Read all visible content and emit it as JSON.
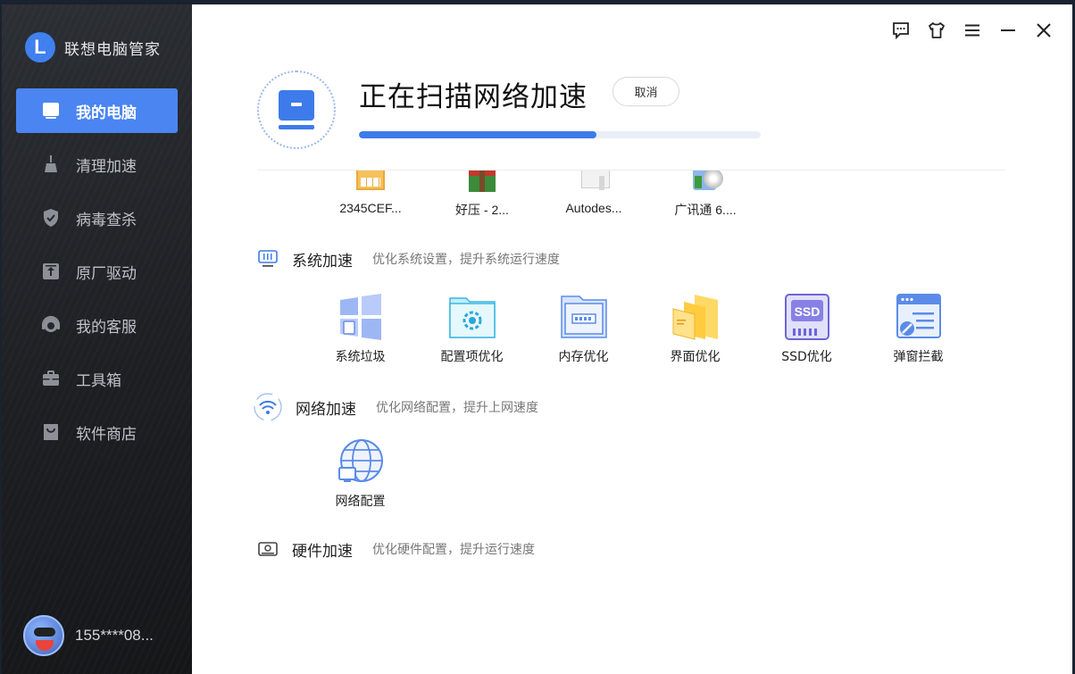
{
  "brand": {
    "logo_letter": "L",
    "name": "联想电脑管家"
  },
  "sidebar": {
    "items": [
      {
        "label": "我的电脑",
        "icon": "laptop-icon",
        "active": true
      },
      {
        "label": "清理加速",
        "icon": "broom-icon",
        "active": false
      },
      {
        "label": "病毒查杀",
        "icon": "shield-icon",
        "active": false
      },
      {
        "label": "原厂驱动",
        "icon": "upload-box-icon",
        "active": false
      },
      {
        "label": "我的客服",
        "icon": "headset-icon",
        "active": false
      },
      {
        "label": "工具箱",
        "icon": "toolbox-icon",
        "active": false
      },
      {
        "label": "软件商店",
        "icon": "bag-icon",
        "active": false
      }
    ],
    "user": {
      "name": "155****08..."
    }
  },
  "window": {
    "controls": [
      "feedback-icon",
      "skin-shirt-icon",
      "menu-icon",
      "minimize-icon",
      "close-icon"
    ]
  },
  "scan": {
    "title": "正在扫描网络加速",
    "cancel_label": "取消",
    "progress": 0.59
  },
  "startup_apps": {
    "items": [
      {
        "label": "2345CEF..."
      },
      {
        "label": "好压 - 2..."
      },
      {
        "label": "Autodes..."
      },
      {
        "label": "广讯通 6...."
      }
    ]
  },
  "sections": {
    "system": {
      "title": "系统加速",
      "desc": "优化系统设置，提升系统运行速度",
      "tiles": [
        {
          "label": "系统垃圾",
          "icon": "windows-trash-icon"
        },
        {
          "label": "配置项优化",
          "icon": "gear-folder-icon"
        },
        {
          "label": "内存优化",
          "icon": "memory-chip-icon"
        },
        {
          "label": "界面优化",
          "icon": "layers-icon"
        },
        {
          "label": "SSD优化",
          "icon": "ssd-icon",
          "ssd_text": "SSD"
        },
        {
          "label": "弹窗拦截",
          "icon": "popup-block-icon"
        }
      ]
    },
    "network": {
      "title": "网络加速",
      "desc": "优化网络配置，提升上网速度",
      "tiles": [
        {
          "label": "网络配置",
          "icon": "globe-icon"
        }
      ]
    },
    "hardware": {
      "title": "硬件加速",
      "desc": "优化硬件配置，提升运行速度"
    }
  },
  "colors": {
    "accent": "#4a85f2",
    "progress": "#3d7bea",
    "track": "#e9eef8"
  }
}
